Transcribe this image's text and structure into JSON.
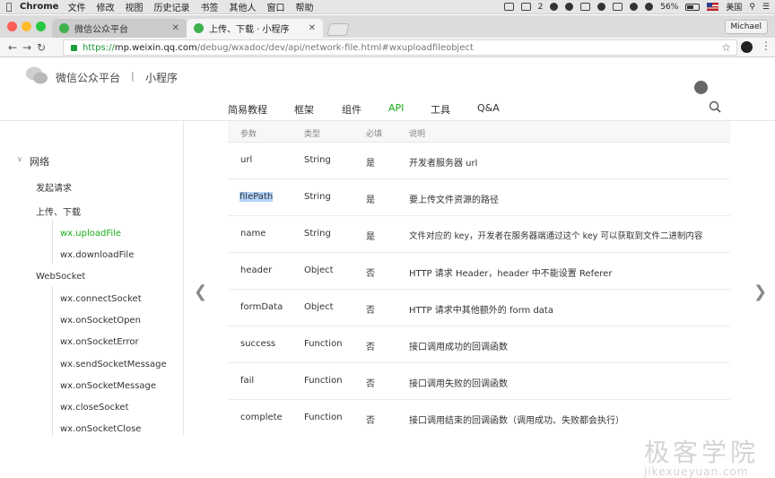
{
  "menubar": {
    "app": "Chrome",
    "menus": [
      "文件",
      "修改",
      "视图",
      "历史记录",
      "书签",
      "其他人",
      "窗口",
      "帮助"
    ],
    "badge": "2",
    "battery": "56%",
    "input_lang": "美国"
  },
  "tabs": [
    {
      "title": "微信公众平台",
      "active": false
    },
    {
      "title": "上传、下载 · 小程序",
      "active": true
    }
  ],
  "profile": "Michael",
  "address": {
    "scheme": "https://",
    "host": "mp.weixin.qq.com",
    "path": "/debug/wxadoc/dev/api/network-file.html#wxuploadfileobject"
  },
  "header": {
    "logo_text": "微信公众平台",
    "separator": "|",
    "subtitle": "小程序"
  },
  "topnav": [
    {
      "label": "简易教程",
      "active": false
    },
    {
      "label": "框架",
      "active": false
    },
    {
      "label": "组件",
      "active": false
    },
    {
      "label": "API",
      "active": true
    },
    {
      "label": "工具",
      "active": false
    },
    {
      "label": "Q&A",
      "active": false
    }
  ],
  "sidebar": {
    "section": "网络",
    "items": [
      {
        "label": "发起请求",
        "level": 1,
        "active": false
      },
      {
        "label": "上传、下载",
        "level": 1,
        "active": false
      },
      {
        "label": "wx.uploadFile",
        "level": 2,
        "active": true
      },
      {
        "label": "wx.downloadFile",
        "level": 2,
        "active": false
      },
      {
        "label": "WebSocket",
        "level": 1,
        "active": false
      },
      {
        "label": "wx.connectSocket",
        "level": 2,
        "active": false
      },
      {
        "label": "wx.onSocketOpen",
        "level": 2,
        "active": false
      },
      {
        "label": "wx.onSocketError",
        "level": 2,
        "active": false
      },
      {
        "label": "wx.sendSocketMessage",
        "level": 2,
        "active": false
      },
      {
        "label": "wx.onSocketMessage",
        "level": 2,
        "active": false
      },
      {
        "label": "wx.closeSocket",
        "level": 2,
        "active": false
      },
      {
        "label": "wx.onSocketClose",
        "level": 2,
        "active": false
      }
    ]
  },
  "table": {
    "columns": [
      "参数",
      "类型",
      "必填",
      "说明"
    ],
    "rows": [
      {
        "param": "url",
        "type": "String",
        "required": "是",
        "desc": "开发者服务器 url"
      },
      {
        "param": "filePath",
        "type": "String",
        "required": "是",
        "desc": "要上传文件资源的路径"
      },
      {
        "param": "name",
        "type": "String",
        "required": "是",
        "desc": "文件对应的 key，开发者在服务器端通过这个 key 可以获取到文件二进制内容"
      },
      {
        "param": "header",
        "type": "Object",
        "required": "否",
        "desc": "HTTP 请求 Header，header 中不能设置 Referer"
      },
      {
        "param": "formData",
        "type": "Object",
        "required": "否",
        "desc": "HTTP 请求中其他额外的 form data"
      },
      {
        "param": "success",
        "type": "Function",
        "required": "否",
        "desc": "接口调用成功的回调函数"
      },
      {
        "param": "fail",
        "type": "Function",
        "required": "否",
        "desc": "接口调用失败的回调函数"
      },
      {
        "param": "complete",
        "type": "Function",
        "required": "否",
        "desc": "接口调用结束的回调函数（调用成功、失败都会执行）"
      }
    ]
  },
  "watermark": {
    "cn": "极客学院",
    "en": "jikexueyuan.com"
  },
  "colors": {
    "accent": "#1aad19",
    "selection": "#b3d4fc"
  }
}
